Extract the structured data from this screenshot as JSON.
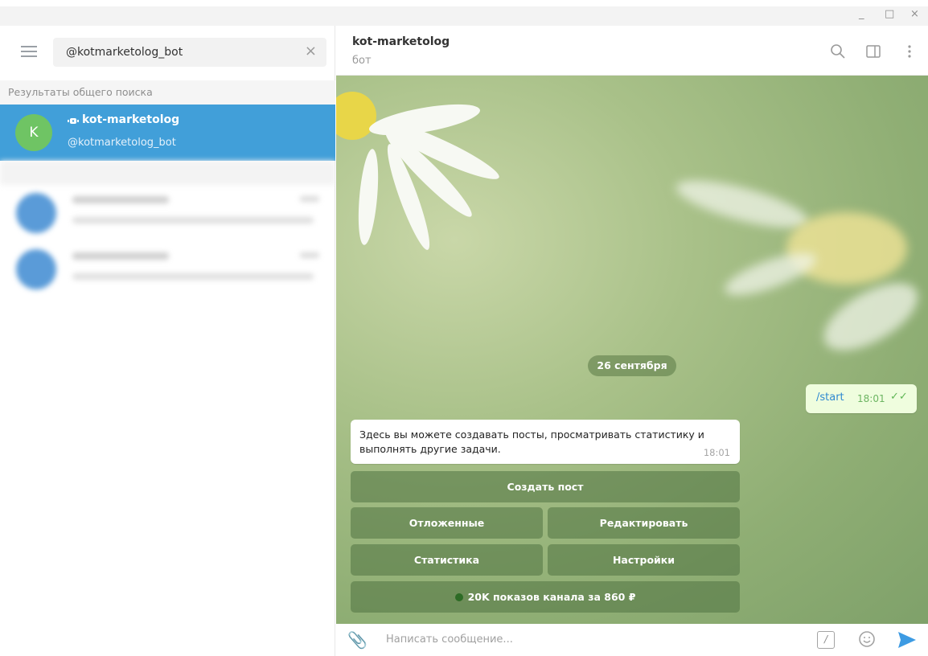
{
  "window": {
    "minimize": "_",
    "maximize": "□",
    "close": "×"
  },
  "search": {
    "value": "@kotmarketolog_bot"
  },
  "sidebar": {
    "section_label": "Результаты общего поиска",
    "result": {
      "avatar_letter": "K",
      "name": "kot-marketolog",
      "handle": "@kotmarketolog_bot",
      "avatar_color": "#6fc464",
      "highlight_color": "#419fd9"
    }
  },
  "chat": {
    "title": "kot-marketolog",
    "subtitle": "бот",
    "date": "26 сентября",
    "outgoing": {
      "text": "/start",
      "time": "18:01"
    },
    "incoming": {
      "text": "Здесь вы можете создавать посты, просматривать статистику и выполнять другие задачи.",
      "time": "18:01"
    },
    "keyboard": {
      "create_post": "Создать пост",
      "scheduled": "Отложенные",
      "edit": "Редактировать",
      "stats": "Статистика",
      "settings": "Настройки",
      "promo": "20K показов канала за 860 ₽"
    }
  },
  "composer": {
    "placeholder": "Написать сообщение..."
  },
  "icons": [
    "menu-icon",
    "close-icon",
    "bot-icon",
    "search-icon",
    "sidebar-toggle-icon",
    "more-icon",
    "attach-icon",
    "command-icon",
    "emoji-icon",
    "send-icon"
  ]
}
